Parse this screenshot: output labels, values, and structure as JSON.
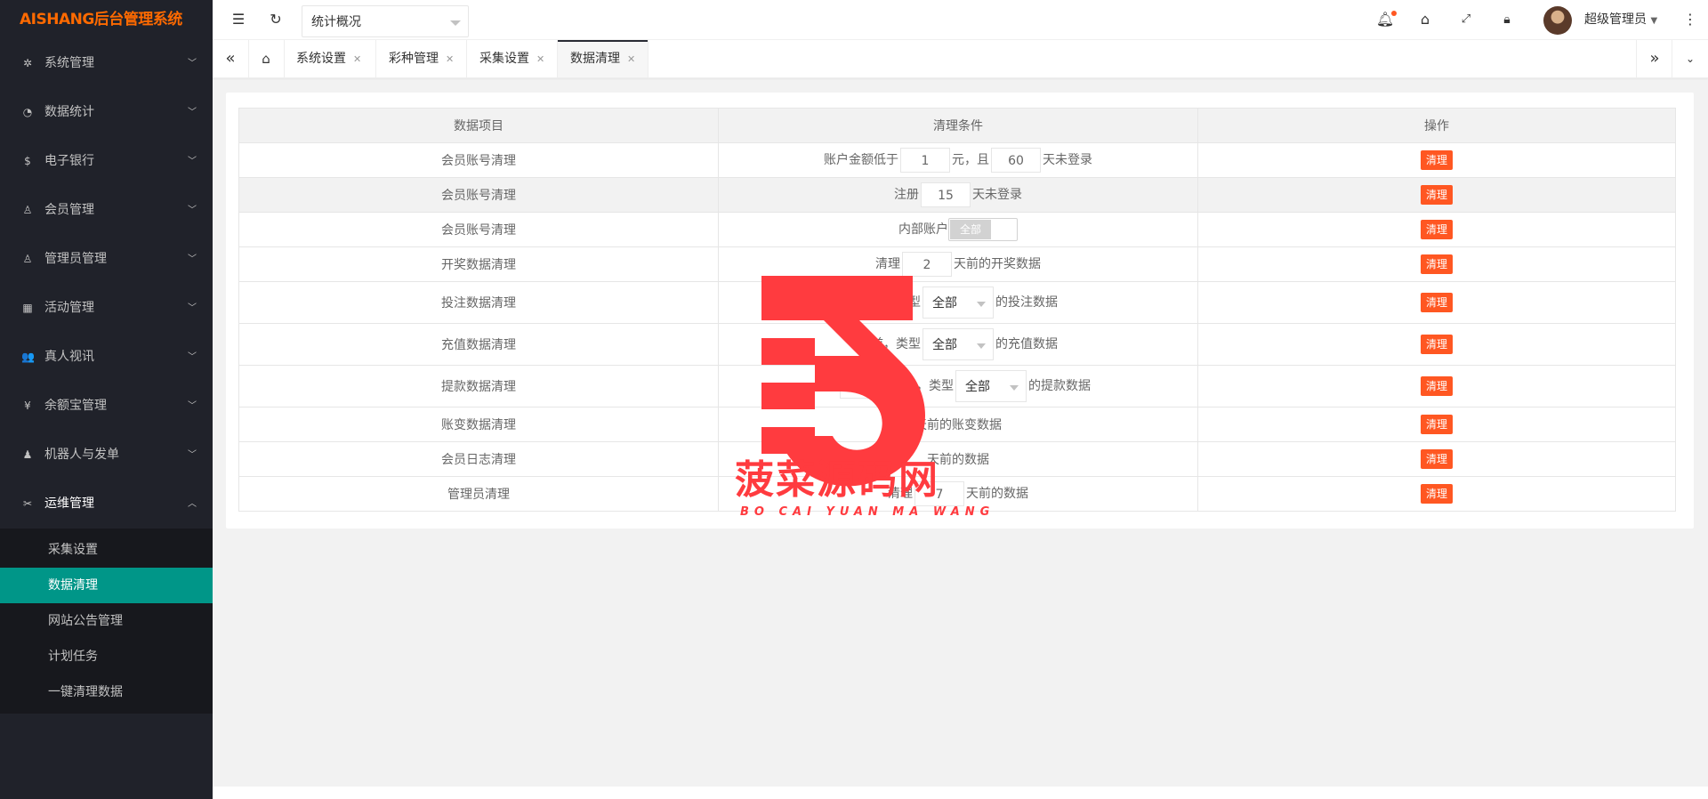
{
  "brand": "AISHANG后台管理系统",
  "sidebar": {
    "items": [
      {
        "label": "系统管理",
        "icon": "gear-icon",
        "glyph": "✲"
      },
      {
        "label": "数据统计",
        "icon": "dashboard-icon",
        "glyph": "◔"
      },
      {
        "label": "电子银行",
        "icon": "dollar-icon",
        "glyph": "$"
      },
      {
        "label": "会员管理",
        "icon": "users-icon",
        "glyph": "♙"
      },
      {
        "label": "管理员管理",
        "icon": "user-icon",
        "glyph": "♙"
      },
      {
        "label": "活动管理",
        "icon": "gift-icon",
        "glyph": "▦"
      },
      {
        "label": "真人视讯",
        "icon": "group-icon",
        "glyph": "👥"
      },
      {
        "label": "余额宝管理",
        "icon": "yen-icon",
        "glyph": "¥"
      },
      {
        "label": "机器人与发单",
        "icon": "robot-icon",
        "glyph": "♟"
      },
      {
        "label": "运维管理",
        "icon": "tools-icon",
        "glyph": "✂"
      }
    ],
    "subitems": [
      {
        "label": "采集设置"
      },
      {
        "label": "数据清理"
      },
      {
        "label": "网站公告管理"
      },
      {
        "label": "计划任务"
      },
      {
        "label": "一键清理数据"
      }
    ]
  },
  "header": {
    "select_value": "统计概况",
    "user_name": "超级管理员"
  },
  "tabs": [
    {
      "label": "系统设置"
    },
    {
      "label": "彩种管理"
    },
    {
      "label": "采集设置"
    },
    {
      "label": "数据清理"
    }
  ],
  "table": {
    "headers": [
      "数据项目",
      "清理条件",
      "操作"
    ],
    "action_label": "清理",
    "rows": [
      {
        "name": "会员账号清理",
        "pre": "账户金额低于",
        "v1": "1",
        "mid": "元，且",
        "v2": "60",
        "post": "天未登录"
      },
      {
        "name": "会员账号清理",
        "pre": "注册",
        "v1": "15",
        "post": "天未登录"
      },
      {
        "name": "会员账号清理",
        "pre": "内部账户",
        "switch_label": "全部"
      },
      {
        "name": "开奖数据清理",
        "pre": "清理",
        "v1": "2",
        "post": "天前的开奖数据"
      },
      {
        "name": "投注数据清理",
        "pre": "天前，类型",
        "sel": "全部",
        "post": "的投注数据"
      },
      {
        "name": "充值数据清理",
        "pre": "天前，类型",
        "sel": "全部",
        "post": "的充值数据"
      },
      {
        "name": "提款数据清理",
        "pre": "理",
        "v1": "45",
        "mid": "天前，类型",
        "sel": "全部",
        "post": "的提款数据"
      },
      {
        "name": "账变数据清理",
        "post": "天前的账变数据"
      },
      {
        "name": "会员日志清理",
        "post": "天前的数据"
      },
      {
        "name": "管理员清理",
        "pre": "清理",
        "v1": "7",
        "post": "天前的数据"
      }
    ]
  },
  "watermark": {
    "title": "菠菜源码网",
    "subtitle": "BO CAI YUAN MA WANG",
    "color": "#ff3b3f"
  },
  "colors": {
    "sidebar_bg": "#20222a",
    "active_green": "#009688",
    "brand_orange": "#ff6a00",
    "danger": "#ff5722"
  }
}
